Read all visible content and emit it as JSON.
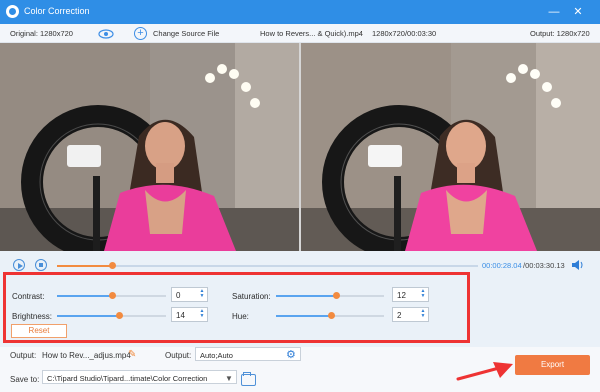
{
  "window": {
    "title": "Color Correction",
    "minimize_icon": "minimize-icon",
    "close_icon": "close-icon",
    "minimize_symbol": "—",
    "close_symbol": "✕"
  },
  "info": {
    "original_label": "Original: 1280x720",
    "change_source": "Change Source File",
    "file_name": "How to Revers... & Quick).mp4",
    "source_resolution": "1280x720/00:03:30",
    "output_label": "Output: 1280x720"
  },
  "playback": {
    "current_time": "00:00:28.04",
    "total_time": "/00:03:30.13",
    "progress": 0.13
  },
  "adjustments": {
    "contrast": {
      "label": "Contrast:",
      "value": "0",
      "level": 0.5
    },
    "brightness": {
      "label": "Brightness:",
      "value": "14",
      "level": 0.57
    },
    "saturation": {
      "label": "Saturation:",
      "value": "12",
      "level": 0.56
    },
    "hue": {
      "label": "Hue:",
      "value": "2",
      "level": 0.51
    },
    "spinner_up": "▲",
    "spinner_down": "▼",
    "reset_label": "Reset"
  },
  "output": {
    "name_label": "Output:",
    "name_value": "How to Rev..._adjus.mp4",
    "format_label": "Output:",
    "format_value": "Auto;Auto",
    "save_label": "Save to:",
    "save_path": "C:\\Tipard Studio\\Tipard...timate\\Color Correction",
    "export_label": "Export",
    "pencil_symbol": "✎",
    "gear_symbol": "⚙",
    "dropdown_symbol": "▼"
  },
  "colors": {
    "titlebar": "#2f8ee6",
    "accent_orange": "#f28b40",
    "slider_blue": "#5aa4ef",
    "highlight_red": "#e33333"
  }
}
